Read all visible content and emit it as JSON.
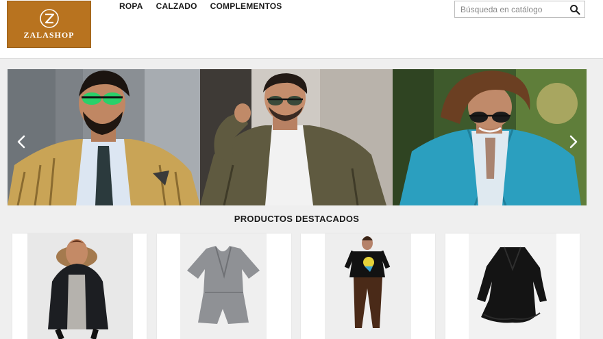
{
  "brand": {
    "name": "ZALASHOP",
    "accent": "#b8731f"
  },
  "nav": [
    {
      "label": "ROPA"
    },
    {
      "label": "CALZADO"
    },
    {
      "label": "COMPLEMENTOS"
    }
  ],
  "search": {
    "placeholder": "Búsqueda en catálogo",
    "icon": "search-icon"
  },
  "carousel": {
    "slides": [
      {
        "subject": "man-green-sunglasses-mustard-blazer"
      },
      {
        "subject": "man-denim-jacket-sunglasses"
      },
      {
        "subject": "man-turquoise-blazer-long-hair"
      }
    ],
    "prev_icon": "chevron-left-icon",
    "next_icon": "chevron-right-icon"
  },
  "featured": {
    "title": "PRODUCTOS DESTACADOS",
    "products": [
      {
        "subject": "black-parka-fur-hood"
      },
      {
        "subject": "grey-wrap-playsuit"
      },
      {
        "subject": "graphic-tee-brown-trousers"
      },
      {
        "subject": "black-ruffle-dress"
      }
    ]
  }
}
